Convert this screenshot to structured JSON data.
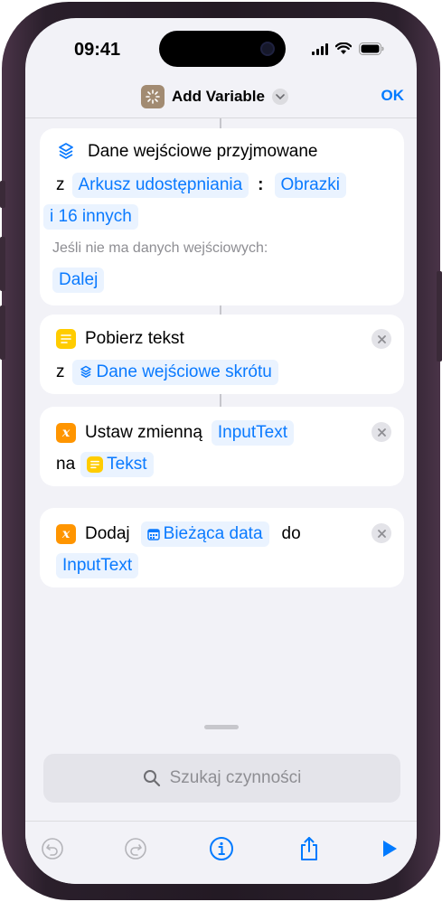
{
  "status_bar": {
    "time": "09:41"
  },
  "nav": {
    "title": "Add Variable",
    "ok_label": "OK"
  },
  "actions": [
    {
      "title": "Dane wejściowe przyjmowane",
      "from_word": "z",
      "source_chip": "Arkusz udostępniania",
      "separator": ":",
      "type_chip_line1": "Obrazki",
      "type_chip_line2": "i 16 innych",
      "no_input_label": "Jeśli nie ma danych wejściowych:",
      "no_input_chip": "Dalej"
    },
    {
      "title": "Pobierz tekst",
      "from_word": "z",
      "input_chip": "Dane wejściowe skrótu"
    },
    {
      "title": "Ustaw zmienną",
      "variable_chip": "InputText",
      "to_word": "na",
      "value_chip": "Tekst"
    },
    {
      "title": "Dodaj",
      "value_chip": "Bieżąca data",
      "to_word": "do",
      "variable_chip": "InputText"
    }
  ],
  "search": {
    "placeholder": "Szukaj czynności"
  },
  "colors": {
    "accent": "#007aff",
    "chip_bg": "#eaf3ff",
    "variable_icon": "#ff9500",
    "text_icon": "#ffcc00"
  }
}
